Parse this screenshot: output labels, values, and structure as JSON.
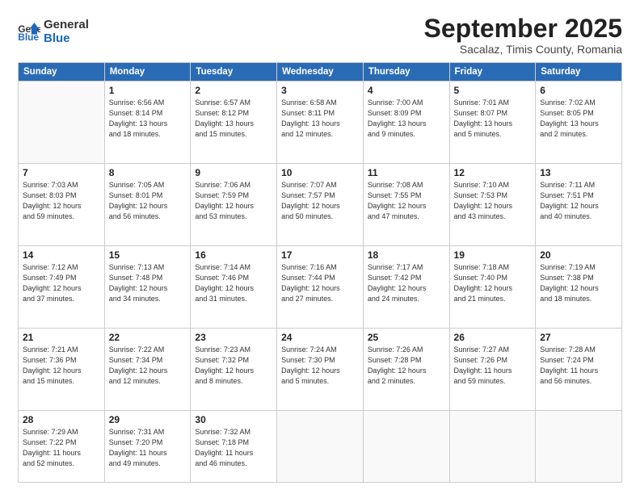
{
  "logo": {
    "line1": "General",
    "line2": "Blue"
  },
  "title": "September 2025",
  "subtitle": "Sacalaz, Timis County, Romania",
  "header": {
    "days": [
      "Sunday",
      "Monday",
      "Tuesday",
      "Wednesday",
      "Thursday",
      "Friday",
      "Saturday"
    ]
  },
  "weeks": [
    [
      {
        "day": "",
        "info": ""
      },
      {
        "day": "1",
        "info": "Sunrise: 6:56 AM\nSunset: 8:14 PM\nDaylight: 13 hours\nand 18 minutes."
      },
      {
        "day": "2",
        "info": "Sunrise: 6:57 AM\nSunset: 8:12 PM\nDaylight: 13 hours\nand 15 minutes."
      },
      {
        "day": "3",
        "info": "Sunrise: 6:58 AM\nSunset: 8:11 PM\nDaylight: 13 hours\nand 12 minutes."
      },
      {
        "day": "4",
        "info": "Sunrise: 7:00 AM\nSunset: 8:09 PM\nDaylight: 13 hours\nand 9 minutes."
      },
      {
        "day": "5",
        "info": "Sunrise: 7:01 AM\nSunset: 8:07 PM\nDaylight: 13 hours\nand 5 minutes."
      },
      {
        "day": "6",
        "info": "Sunrise: 7:02 AM\nSunset: 8:05 PM\nDaylight: 13 hours\nand 2 minutes."
      }
    ],
    [
      {
        "day": "7",
        "info": "Sunrise: 7:03 AM\nSunset: 8:03 PM\nDaylight: 12 hours\nand 59 minutes."
      },
      {
        "day": "8",
        "info": "Sunrise: 7:05 AM\nSunset: 8:01 PM\nDaylight: 12 hours\nand 56 minutes."
      },
      {
        "day": "9",
        "info": "Sunrise: 7:06 AM\nSunset: 7:59 PM\nDaylight: 12 hours\nand 53 minutes."
      },
      {
        "day": "10",
        "info": "Sunrise: 7:07 AM\nSunset: 7:57 PM\nDaylight: 12 hours\nand 50 minutes."
      },
      {
        "day": "11",
        "info": "Sunrise: 7:08 AM\nSunset: 7:55 PM\nDaylight: 12 hours\nand 47 minutes."
      },
      {
        "day": "12",
        "info": "Sunrise: 7:10 AM\nSunset: 7:53 PM\nDaylight: 12 hours\nand 43 minutes."
      },
      {
        "day": "13",
        "info": "Sunrise: 7:11 AM\nSunset: 7:51 PM\nDaylight: 12 hours\nand 40 minutes."
      }
    ],
    [
      {
        "day": "14",
        "info": "Sunrise: 7:12 AM\nSunset: 7:49 PM\nDaylight: 12 hours\nand 37 minutes."
      },
      {
        "day": "15",
        "info": "Sunrise: 7:13 AM\nSunset: 7:48 PM\nDaylight: 12 hours\nand 34 minutes."
      },
      {
        "day": "16",
        "info": "Sunrise: 7:14 AM\nSunset: 7:46 PM\nDaylight: 12 hours\nand 31 minutes."
      },
      {
        "day": "17",
        "info": "Sunrise: 7:16 AM\nSunset: 7:44 PM\nDaylight: 12 hours\nand 27 minutes."
      },
      {
        "day": "18",
        "info": "Sunrise: 7:17 AM\nSunset: 7:42 PM\nDaylight: 12 hours\nand 24 minutes."
      },
      {
        "day": "19",
        "info": "Sunrise: 7:18 AM\nSunset: 7:40 PM\nDaylight: 12 hours\nand 21 minutes."
      },
      {
        "day": "20",
        "info": "Sunrise: 7:19 AM\nSunset: 7:38 PM\nDaylight: 12 hours\nand 18 minutes."
      }
    ],
    [
      {
        "day": "21",
        "info": "Sunrise: 7:21 AM\nSunset: 7:36 PM\nDaylight: 12 hours\nand 15 minutes."
      },
      {
        "day": "22",
        "info": "Sunrise: 7:22 AM\nSunset: 7:34 PM\nDaylight: 12 hours\nand 12 minutes."
      },
      {
        "day": "23",
        "info": "Sunrise: 7:23 AM\nSunset: 7:32 PM\nDaylight: 12 hours\nand 8 minutes."
      },
      {
        "day": "24",
        "info": "Sunrise: 7:24 AM\nSunset: 7:30 PM\nDaylight: 12 hours\nand 5 minutes."
      },
      {
        "day": "25",
        "info": "Sunrise: 7:26 AM\nSunset: 7:28 PM\nDaylight: 12 hours\nand 2 minutes."
      },
      {
        "day": "26",
        "info": "Sunrise: 7:27 AM\nSunset: 7:26 PM\nDaylight: 11 hours\nand 59 minutes."
      },
      {
        "day": "27",
        "info": "Sunrise: 7:28 AM\nSunset: 7:24 PM\nDaylight: 11 hours\nand 56 minutes."
      }
    ],
    [
      {
        "day": "28",
        "info": "Sunrise: 7:29 AM\nSunset: 7:22 PM\nDaylight: 11 hours\nand 52 minutes."
      },
      {
        "day": "29",
        "info": "Sunrise: 7:31 AM\nSunset: 7:20 PM\nDaylight: 11 hours\nand 49 minutes."
      },
      {
        "day": "30",
        "info": "Sunrise: 7:32 AM\nSunset: 7:18 PM\nDaylight: 11 hours\nand 46 minutes."
      },
      {
        "day": "",
        "info": ""
      },
      {
        "day": "",
        "info": ""
      },
      {
        "day": "",
        "info": ""
      },
      {
        "day": "",
        "info": ""
      }
    ]
  ]
}
